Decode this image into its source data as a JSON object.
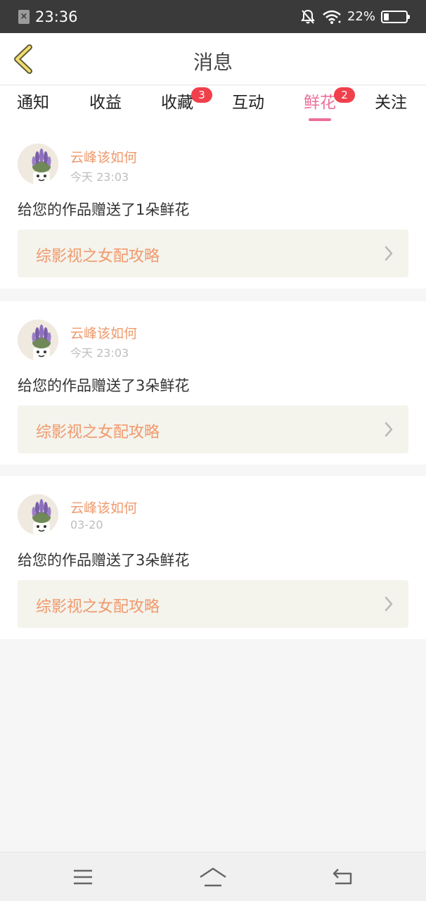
{
  "status_bar": {
    "time": "23:36",
    "battery_percent": "22%",
    "battery_level": 0.22,
    "icons": [
      "sim-error-icon",
      "mute-bell-icon",
      "wifi-icon",
      "battery-icon"
    ]
  },
  "header": {
    "title": "消息",
    "back_icon": "chevron-left-icon"
  },
  "tabs": [
    {
      "label": "通知",
      "badge": null
    },
    {
      "label": "收益",
      "badge": null
    },
    {
      "label": "收藏",
      "badge": "3"
    },
    {
      "label": "互动",
      "badge": null
    },
    {
      "label": "鲜花",
      "badge": "2",
      "active": true
    },
    {
      "label": "关注",
      "badge": null
    }
  ],
  "messages": [
    {
      "user": "云峰该如何",
      "time": "今天 23:03",
      "text": "给您的作品赠送了1朵鲜花",
      "work": "综影视之女配攻略"
    },
    {
      "user": "云峰该如何",
      "time": "今天 23:03",
      "text": "给您的作品赠送了3朵鲜花",
      "work": "综影视之女配攻略"
    },
    {
      "user": "云峰该如何",
      "time": "03-20",
      "text": "给您的作品赠送了3朵鲜花",
      "work": "综影视之女配攻略"
    }
  ],
  "nav_bar": {
    "icons": [
      "menu-icon",
      "home-icon",
      "back-icon"
    ]
  },
  "colors": {
    "accent_pink": "#ec6f9a",
    "badge_red": "#f0404b",
    "name_orange": "#ef9a6d",
    "status_bar_bg": "#3a3a3a",
    "card_link_bg": "#f4f3ec"
  }
}
